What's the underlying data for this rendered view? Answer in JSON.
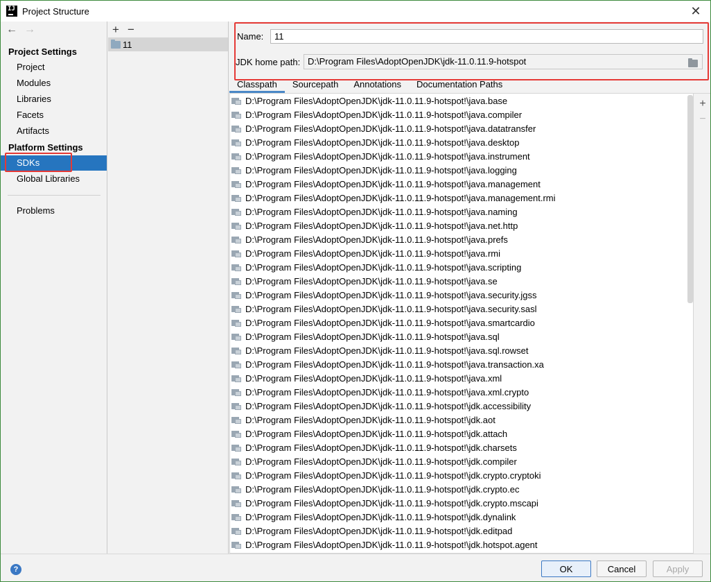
{
  "window": {
    "title": "Project Structure",
    "close_glyph": "✕"
  },
  "nav": {
    "back_glyph": "←",
    "forward_glyph": "→",
    "project_settings_header": "Project Settings",
    "project_settings_items": [
      "Project",
      "Modules",
      "Libraries",
      "Facets",
      "Artifacts"
    ],
    "platform_settings_header": "Platform Settings",
    "platform_settings_items": [
      "SDKs",
      "Global Libraries"
    ],
    "selected": "SDKs",
    "other_items": [
      "Problems"
    ]
  },
  "sdk_list": {
    "add_glyph": "+",
    "remove_glyph": "−",
    "items": [
      "11"
    ]
  },
  "detail": {
    "name_label": "Name:",
    "name_value": "11",
    "jdk_home_label": "JDK home path:",
    "jdk_home_value": "D:\\Program Files\\AdoptOpenJDK\\jdk-11.0.11.9-hotspot",
    "tabs": [
      "Classpath",
      "Sourcepath",
      "Annotations",
      "Documentation Paths"
    ],
    "active_tab": "Classpath",
    "side_add_glyph": "+",
    "side_remove_glyph": "−",
    "classpath": [
      "D:\\Program Files\\AdoptOpenJDK\\jdk-11.0.11.9-hotspot!\\java.base",
      "D:\\Program Files\\AdoptOpenJDK\\jdk-11.0.11.9-hotspot!\\java.compiler",
      "D:\\Program Files\\AdoptOpenJDK\\jdk-11.0.11.9-hotspot!\\java.datatransfer",
      "D:\\Program Files\\AdoptOpenJDK\\jdk-11.0.11.9-hotspot!\\java.desktop",
      "D:\\Program Files\\AdoptOpenJDK\\jdk-11.0.11.9-hotspot!\\java.instrument",
      "D:\\Program Files\\AdoptOpenJDK\\jdk-11.0.11.9-hotspot!\\java.logging",
      "D:\\Program Files\\AdoptOpenJDK\\jdk-11.0.11.9-hotspot!\\java.management",
      "D:\\Program Files\\AdoptOpenJDK\\jdk-11.0.11.9-hotspot!\\java.management.rmi",
      "D:\\Program Files\\AdoptOpenJDK\\jdk-11.0.11.9-hotspot!\\java.naming",
      "D:\\Program Files\\AdoptOpenJDK\\jdk-11.0.11.9-hotspot!\\java.net.http",
      "D:\\Program Files\\AdoptOpenJDK\\jdk-11.0.11.9-hotspot!\\java.prefs",
      "D:\\Program Files\\AdoptOpenJDK\\jdk-11.0.11.9-hotspot!\\java.rmi",
      "D:\\Program Files\\AdoptOpenJDK\\jdk-11.0.11.9-hotspot!\\java.scripting",
      "D:\\Program Files\\AdoptOpenJDK\\jdk-11.0.11.9-hotspot!\\java.se",
      "D:\\Program Files\\AdoptOpenJDK\\jdk-11.0.11.9-hotspot!\\java.security.jgss",
      "D:\\Program Files\\AdoptOpenJDK\\jdk-11.0.11.9-hotspot!\\java.security.sasl",
      "D:\\Program Files\\AdoptOpenJDK\\jdk-11.0.11.9-hotspot!\\java.smartcardio",
      "D:\\Program Files\\AdoptOpenJDK\\jdk-11.0.11.9-hotspot!\\java.sql",
      "D:\\Program Files\\AdoptOpenJDK\\jdk-11.0.11.9-hotspot!\\java.sql.rowset",
      "D:\\Program Files\\AdoptOpenJDK\\jdk-11.0.11.9-hotspot!\\java.transaction.xa",
      "D:\\Program Files\\AdoptOpenJDK\\jdk-11.0.11.9-hotspot!\\java.xml",
      "D:\\Program Files\\AdoptOpenJDK\\jdk-11.0.11.9-hotspot!\\java.xml.crypto",
      "D:\\Program Files\\AdoptOpenJDK\\jdk-11.0.11.9-hotspot!\\jdk.accessibility",
      "D:\\Program Files\\AdoptOpenJDK\\jdk-11.0.11.9-hotspot!\\jdk.aot",
      "D:\\Program Files\\AdoptOpenJDK\\jdk-11.0.11.9-hotspot!\\jdk.attach",
      "D:\\Program Files\\AdoptOpenJDK\\jdk-11.0.11.9-hotspot!\\jdk.charsets",
      "D:\\Program Files\\AdoptOpenJDK\\jdk-11.0.11.9-hotspot!\\jdk.compiler",
      "D:\\Program Files\\AdoptOpenJDK\\jdk-11.0.11.9-hotspot!\\jdk.crypto.cryptoki",
      "D:\\Program Files\\AdoptOpenJDK\\jdk-11.0.11.9-hotspot!\\jdk.crypto.ec",
      "D:\\Program Files\\AdoptOpenJDK\\jdk-11.0.11.9-hotspot!\\jdk.crypto.mscapi",
      "D:\\Program Files\\AdoptOpenJDK\\jdk-11.0.11.9-hotspot!\\jdk.dynalink",
      "D:\\Program Files\\AdoptOpenJDK\\jdk-11.0.11.9-hotspot!\\jdk.editpad",
      "D:\\Program Files\\AdoptOpenJDK\\jdk-11.0.11.9-hotspot!\\jdk.hotspot.agent"
    ]
  },
  "buttons": {
    "help": "?",
    "ok": "OK",
    "cancel": "Cancel",
    "apply": "Apply"
  },
  "colors": {
    "selection": "#2675bf",
    "highlight": "#e53935",
    "window_border": "#3d8a3d"
  }
}
